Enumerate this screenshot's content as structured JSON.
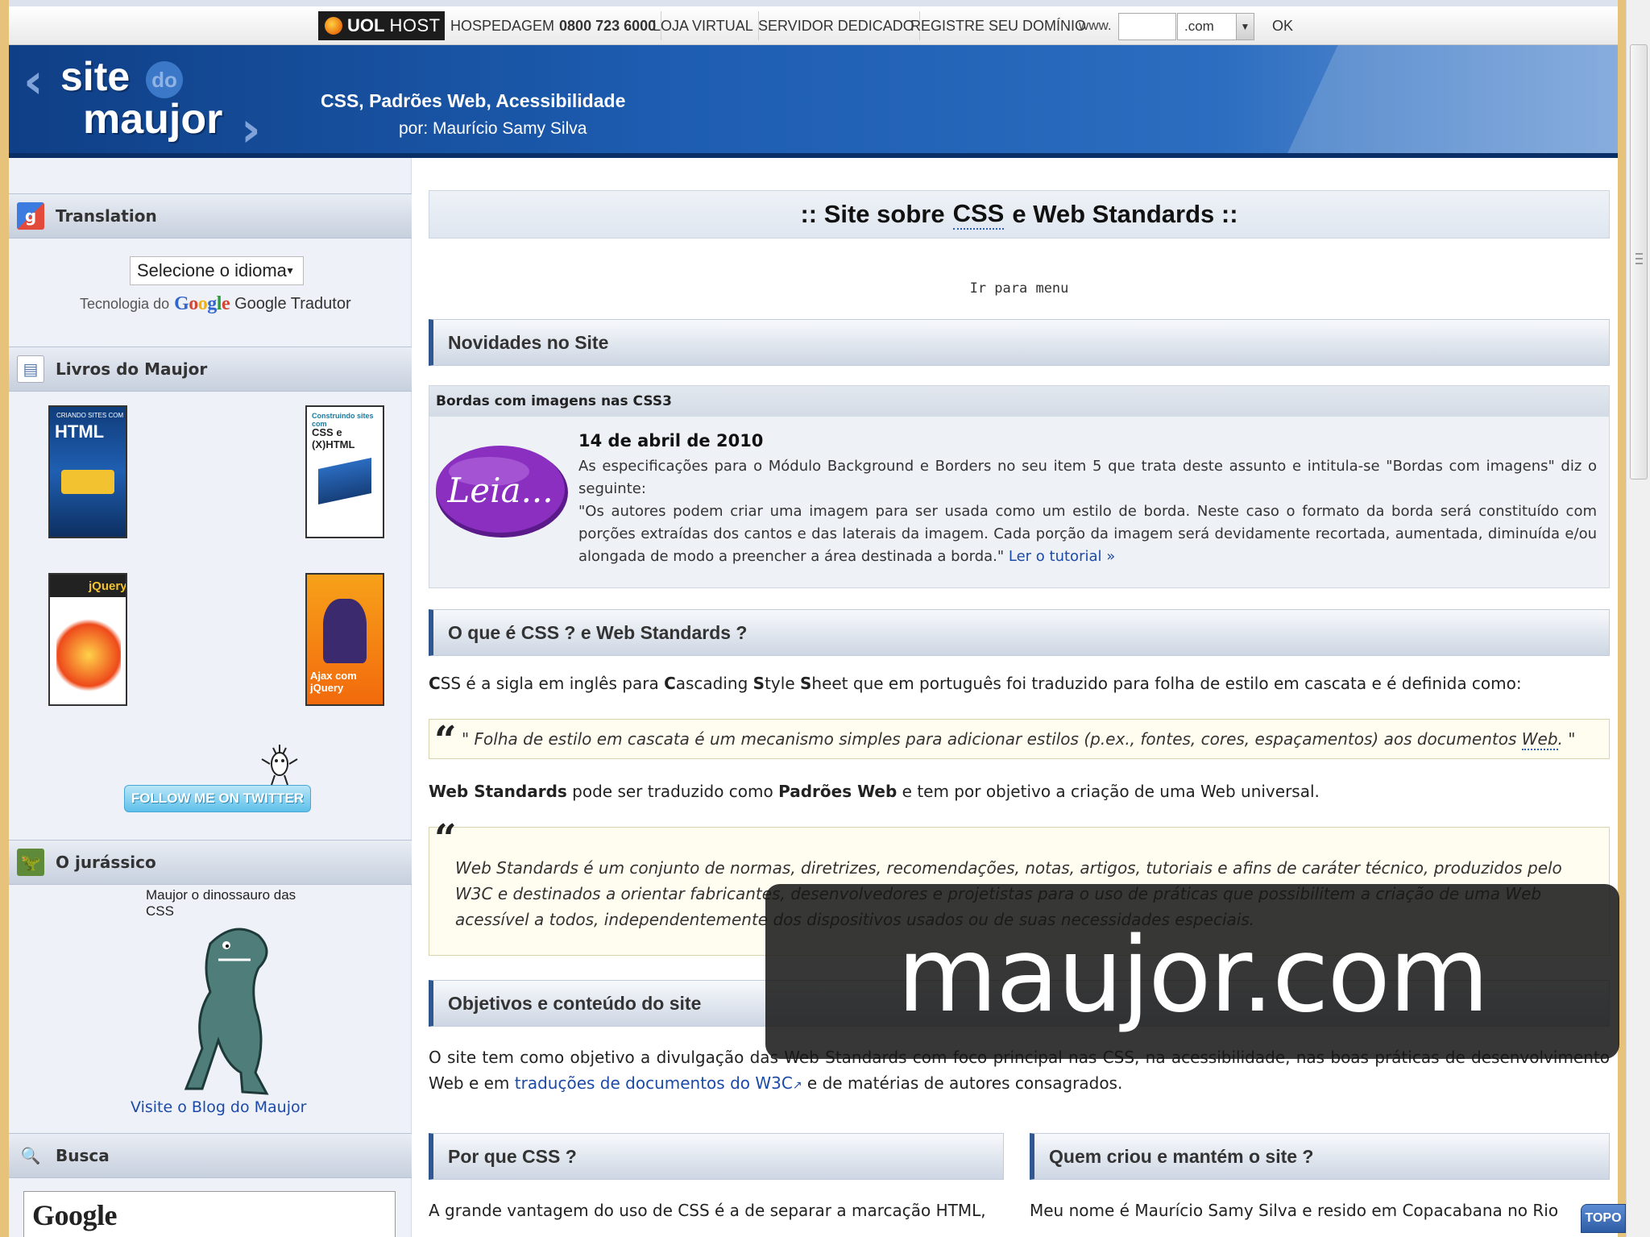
{
  "topbar": {
    "brand": "UOL",
    "brand_suffix": "HOST",
    "hosting_label": "HOSPEDAGEM",
    "hosting_phone": "0800 723 6000",
    "shop_label": "LOJA VIRTUAL",
    "server_label": "SERVIDOR DEDICADO",
    "register_label": "REGISTRE SEU DOMÍNIO",
    "www_prefix": "www.",
    "domain_value": "",
    "tld_selected": ".com",
    "ok_label": "OK"
  },
  "header": {
    "logo_site": "site",
    "logo_do": "do",
    "logo_maujor": "maujor",
    "tagline": "CSS, Padrões Web, Acessibilidade",
    "byline": "por: Maurício Samy Silva"
  },
  "sidebar": {
    "translation_heading": "Translation",
    "language_select": "Selecione o idioma",
    "powered_prefix": "Tecnologia do",
    "google_word": "Google",
    "translator_name": "Google Tradutor",
    "books_heading": "Livros do Maujor",
    "books": [
      {
        "cover_text": "HTML",
        "cover_small": "CRIANDO SITES COM"
      },
      {
        "cover_text": "CSS e (X)HTML",
        "cover_small": "Construindo sites com"
      },
      {
        "cover_text": "jQuery"
      },
      {
        "cover_text": "Ajax com jQuery"
      }
    ],
    "twitter_button": "FOLLOW ME ON TWITTER",
    "jurassic_heading": "O jurássico",
    "dino_caption": "Maujor o dinossauro das CSS",
    "blog_link": "Visite o Blog do Maujor",
    "search_heading": "Busca",
    "search_google": "Google"
  },
  "main": {
    "title_prefix": ":: Site sobre",
    "title_abbr": "CSS",
    "title_suffix": "e Web Standards ::",
    "skip_link": "Ir para menu",
    "news_heading": "Novidades no Site",
    "news_item_title": "Bordas com imagens nas CSS3",
    "news_badge": "Leia...",
    "news_date": "14 de abril de 2010",
    "news_text_1": "As especificações para o Módulo Background e Borders no seu item 5 que trata deste assunto e intitula-se \"Bordas com imagens\" diz o seguinte:",
    "news_text_2": "\"Os autores podem criar uma imagem para ser usada como um estilo de borda. Neste caso o formato da borda será constituído com porções extraídas dos cantos e das laterais da imagem. Cada porção da imagem será devidamente recortada, aumentada, diminuída e/ou alongada de modo a preencher a área destinada a borda.\"",
    "news_link": "Ler o tutorial »",
    "css_heading": "O que é CSS ? e Web Standards ?",
    "css_para": {
      "c": "C",
      "c_rest": "SS é a sigla em inglês para ",
      "cascading_c": "C",
      "cascading_rest": "ascading ",
      "style_s": "S",
      "style_rest": "tyle ",
      "sheet_s": "S",
      "sheet_rest": "heet que em português foi traduzido para folha de estilo em cascata e é definida como:"
    },
    "css_quote": "\" Folha de estilo em cascata é um mecanismo simples para adicionar estilos (p.ex., fontes, cores, espaçamentos) aos documentos",
    "css_quote_link": "Web",
    "css_quote_end": ". \"",
    "ws_para": {
      "ws_bold": "Web Standards",
      "ws_mid": " pode ser traduzido como ",
      "pw_bold": "Padrões Web",
      "ws_end": " e tem por objetivo a criação de uma Web universal."
    },
    "ws_quote": "Web Standards é um conjunto de normas, diretrizes, recomendações, notas, artigos, tutoriais e afins de caráter técnico, produzidos pelo W3C e destinados a orientar fabricantes, desenvolvedores e projetistas para o uso de práticas que possibilitem a criação de uma Web acessível a todos, independentemente dos dispositivos usados ou de suas necessidades especiais.",
    "goals_heading": "Objetivos e conteúdo do site",
    "goals_text_1": "O site tem como objetivo a divulgação das Web Standards com foco principal nas CSS, na acessibilidade, nas boas práticas de desenvolvimento Web e em",
    "goals_link": "traduções de documentos do W3C",
    "goals_text_2": "e de matérias de autores consagrados.",
    "why_heading": "Por que CSS ?",
    "who_heading": "Quem criou e mantém o site ?",
    "why_text": "A grande vantagem do uso de CSS é a de separar a marcação HTML,",
    "who_text": "Meu nome é Maurício Samy Silva e resido em Copacabana no Rio"
  },
  "watermark": "maujor.com",
  "topo_button": "TOPO",
  "colors": {
    "header_blue": "#1d5cb0",
    "link_blue": "#1b4aa8",
    "frame_gold": "#e6c27a",
    "leia_purple": "#8a2fc0"
  }
}
